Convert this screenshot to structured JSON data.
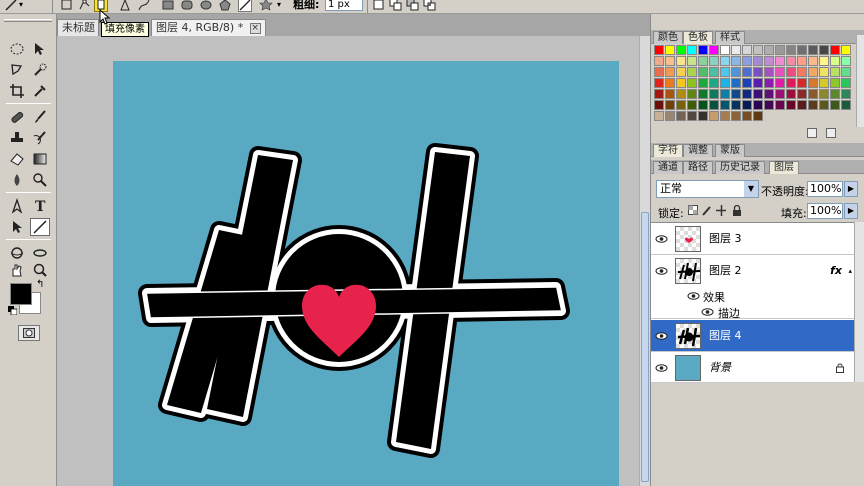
{
  "options_bar": {
    "fill_pixels_tooltip": "填充像素",
    "weight_label": "粗细:",
    "weight_value": "1 px"
  },
  "document_tabs": [
    {
      "label": "未标题"
    },
    {
      "label": "图层 4, RGB/8) *"
    }
  ],
  "tools": {
    "foreground_color": "#000000",
    "background_color": "#ffffff"
  },
  "canvas": {
    "background_color": "#59a9c3",
    "heart_color": "#e8234b"
  },
  "panels": {
    "swatches_tabs": [
      "颜色",
      "色板",
      "样式"
    ],
    "swatches_active": "色板",
    "character_tabs": [
      "字符",
      "调整",
      "蒙版"
    ],
    "layers_tabs": [
      "通道",
      "路径",
      "历史记录",
      "图层"
    ],
    "layers_active": "图层"
  },
  "swatches": [
    "#ff0000",
    "#ffff00",
    "#00ff00",
    "#00ffff",
    "#0000ff",
    "#ff00ff",
    "#ffffff",
    "#ebebeb",
    "#d6d6d6",
    "#c2c2c2",
    "#adadad",
    "#999999",
    "#858585",
    "#707070",
    "#5c5c5c",
    "#474747",
    "#ff0000",
    "#ffff00",
    "#f2a98a",
    "#f7c08a",
    "#fbe38a",
    "#c8e38a",
    "#8ad19c",
    "#8ad1c0",
    "#8ad6f2",
    "#8ab6e8",
    "#8a9ee0",
    "#a38ad6",
    "#c48ad6",
    "#f28ad1",
    "#f28aa6",
    "#ff9c8a",
    "#ffb88a",
    "#fff48a",
    "#d9ff8a",
    "#8affa6",
    "#e86c4f",
    "#f29a4f",
    "#f7d04f",
    "#a8d44f",
    "#4fbf6c",
    "#4fbfa3",
    "#4fc6ec",
    "#4f95d9",
    "#4f6fcf",
    "#7a4fc4",
    "#a84fc4",
    "#e84fbf",
    "#e84f7f",
    "#f27a61",
    "#f2a861",
    "#f2e061",
    "#b8e061",
    "#61e08a",
    "#e0261c",
    "#ec7a1c",
    "#f5c61c",
    "#8cc41c",
    "#1caa3c",
    "#1caa82",
    "#1cb4e6",
    "#1c6ec8",
    "#1c42b8",
    "#5a1cb0",
    "#8c1cb0",
    "#e01ca8",
    "#e01c5a",
    "#d42a2a",
    "#d47a2a",
    "#d4c82a",
    "#8cc82a",
    "#2ac85a",
    "#a01a12",
    "#a8560f",
    "#b08c0f",
    "#5e880f",
    "#0f7a28",
    "#0f7a5c",
    "#0f7ea4",
    "#0f4c8c",
    "#0f2a80",
    "#3e0f7a",
    "#620f7a",
    "#9e0f76",
    "#9e0f3e",
    "#8a2a2a",
    "#8a5a2a",
    "#8a882a",
    "#5a882a",
    "#2a885a",
    "#6a0f0a",
    "#704006",
    "#7a6206",
    "#3e5e06",
    "#065218",
    "#06523c",
    "#06566e",
    "#06325e",
    "#061c56",
    "#2a0652",
    "#420652",
    "#6a064e",
    "#6a0628",
    "#5a1c1c",
    "#5a3c1c",
    "#5a5a1c",
    "#3c5a1c",
    "#1c5a3c",
    "#c7b299",
    "#998675",
    "#736357",
    "#534741",
    "#37302a",
    "#c69c6d",
    "#a67c52",
    "#8c6239",
    "#754c24",
    "#603913"
  ],
  "layer_controls": {
    "blend_mode": "正常",
    "opacity_label": "不透明度:",
    "opacity_value": "100%",
    "lock_label": "锁定:",
    "fill_label": "填充:",
    "fill_value": "100%"
  },
  "layers": {
    "layer3_name": "图层 3",
    "layer2_name": "图层 2",
    "layer2_fx": "fx",
    "effects_label": "效果",
    "stroke_label": "描边",
    "layer4_name": "图层 4",
    "background_name": "背景"
  }
}
